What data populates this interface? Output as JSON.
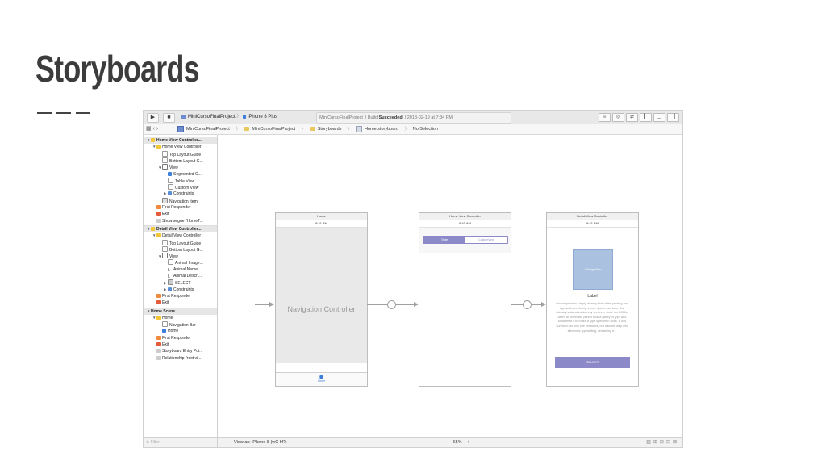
{
  "slide": {
    "title": "Storyboards"
  },
  "toolbar": {
    "run_icon": "▶",
    "stop_icon": "■",
    "scheme_project": "MiniCursoFinalProject",
    "scheme_device": "iPhone 8 Plus",
    "status_project": "MiniCursoFinalProject",
    "status_build_label": "Build",
    "status_build_result": "Succeeded",
    "status_time": "2018-02-19 at 7:34 PM",
    "right_icons": [
      "editor-standard-icon",
      "assistant-editor-icon",
      "version-editor-icon",
      "navigator-toggle-icon",
      "debug-toggle-icon",
      "utilities-toggle-icon"
    ]
  },
  "jumpbar": {
    "nav_icons": "▦  ‹  ›",
    "crumbs": [
      "MiniCursoFinalProject",
      "MiniCursoFinalProject",
      "Storyboards",
      "Home.storyboard",
      "No Selection"
    ]
  },
  "outline": [
    {
      "label": "Home View Controller...",
      "level": 0,
      "disc": "▼",
      "icon": "vc",
      "sel": true
    },
    {
      "label": "Home View Controller",
      "level": 1,
      "disc": "▼",
      "icon": "vc"
    },
    {
      "label": "Top Layout Guide",
      "level": 2,
      "disc": "",
      "icon": "guide"
    },
    {
      "label": "Bottom Layout G...",
      "level": 2,
      "disc": "",
      "icon": "guide"
    },
    {
      "label": "View",
      "level": 2,
      "disc": "▼",
      "icon": "view"
    },
    {
      "label": "Segmented C...",
      "level": 3,
      "disc": "",
      "icon": "seg"
    },
    {
      "label": "Table View",
      "level": 3,
      "disc": "",
      "icon": "guide"
    },
    {
      "label": "Custom View",
      "level": 3,
      "disc": "",
      "icon": "guide"
    },
    {
      "label": "Constraints",
      "level": 3,
      "disc": "▶",
      "icon": "con"
    },
    {
      "label": "Navigation Item",
      "level": 2,
      "disc": "",
      "icon": "nav"
    },
    {
      "label": "First Responder",
      "level": 1,
      "disc": "",
      "icon": "fr"
    },
    {
      "label": "Exit",
      "level": 1,
      "disc": "",
      "icon": "exit"
    },
    {
      "label": "Show segue \"HomeT...",
      "level": 1,
      "disc": "",
      "icon": "segue"
    },
    {
      "label": "Detail View Controller...",
      "level": 0,
      "disc": "▼",
      "icon": "vc",
      "sel": true
    },
    {
      "label": "Detail View Controller",
      "level": 1,
      "disc": "▼",
      "icon": "vc"
    },
    {
      "label": "Top Layout Guide",
      "level": 2,
      "disc": "",
      "icon": "guide"
    },
    {
      "label": "Bottom Layout G...",
      "level": 2,
      "disc": "",
      "icon": "guide"
    },
    {
      "label": "View",
      "level": 2,
      "disc": "▼",
      "icon": "view"
    },
    {
      "label": "Animal Image...",
      "level": 3,
      "disc": "",
      "icon": "guide"
    },
    {
      "label": "Animal Name...",
      "level": 3,
      "disc": "",
      "icon": "lbl"
    },
    {
      "label": "Animal Descri...",
      "level": 3,
      "disc": "",
      "icon": "lbl"
    },
    {
      "label": "SELECT",
      "level": 3,
      "disc": "▶",
      "icon": "btn"
    },
    {
      "label": "Constraints",
      "level": 3,
      "disc": "▶",
      "icon": "con"
    },
    {
      "label": "First Responder",
      "level": 1,
      "disc": "",
      "icon": "fr"
    },
    {
      "label": "Exit",
      "level": 1,
      "disc": "",
      "icon": "exit"
    },
    {
      "label": "Home Scene",
      "level": 0,
      "disc": "▼",
      "icon": "none",
      "sel": true
    },
    {
      "label": "Home",
      "level": 1,
      "disc": "▼",
      "icon": "vc"
    },
    {
      "label": "Navigation Bar",
      "level": 2,
      "disc": "",
      "icon": "guide"
    },
    {
      "label": "Home",
      "level": 2,
      "disc": "",
      "icon": "home"
    },
    {
      "label": "First Responder",
      "level": 1,
      "disc": "",
      "icon": "fr"
    },
    {
      "label": "Exit",
      "level": 1,
      "disc": "",
      "icon": "exit"
    },
    {
      "label": "Storyboard Entry Poi...",
      "level": 1,
      "disc": "",
      "icon": "segue"
    },
    {
      "label": "Relationship \"root vi...",
      "level": 1,
      "disc": "",
      "icon": "segue"
    }
  ],
  "filter": {
    "placeholder": "Filter"
  },
  "bottom_bar": {
    "view_as": "View as: iPhone 8 (wC hR)",
    "zoom_minus": "—",
    "zoom_level": "65%",
    "zoom_plus": "+"
  },
  "scenes": {
    "home_nav": {
      "title": "Home",
      "time": "9:41 AM",
      "body_label": "Navigation Controller",
      "tab_label": "Home"
    },
    "home_vc": {
      "title": "Home View Controller",
      "time": "9:41 AM",
      "seg_first": "Table",
      "seg_second": "CustomView"
    },
    "detail_vc": {
      "title": "Detail View Controller",
      "time": "9:41 AM",
      "image_placeholder": "UIImageView",
      "label": "Label",
      "body_text": "Lorem Ipsum is simply dummy text of the printing and typesetting industry. Lorem Ipsum has been the industry's standard dummy text ever since the 1500s, when an unknown printer took a galley of type and scrambled it to make a type specimen book. It has survived not only five centuries, but also the leap into electronic typesetting, remaining e...",
      "button": "SELECT"
    }
  },
  "colors": {
    "accent": "#8b89c8",
    "tab_blue": "#3b7fd8"
  }
}
